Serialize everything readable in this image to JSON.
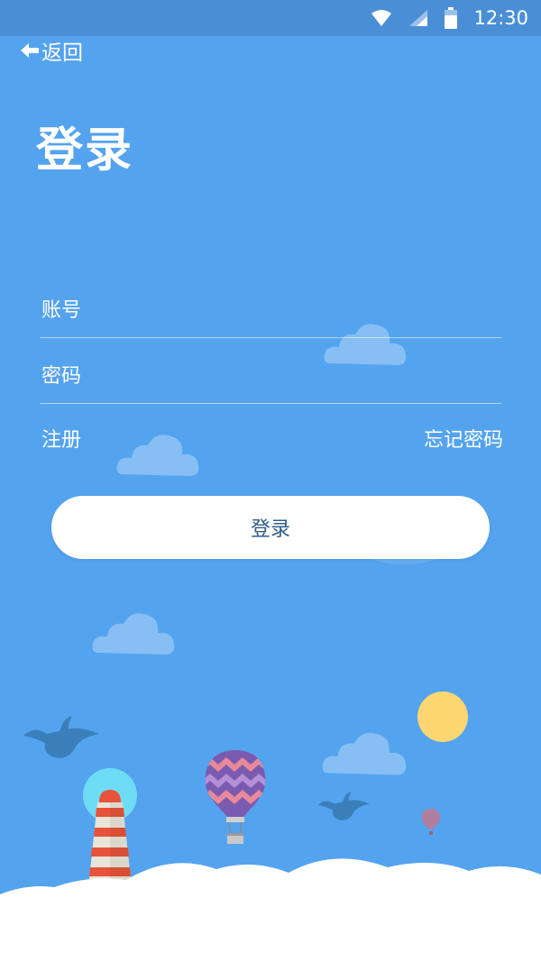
{
  "status_bar": {
    "time": "12:30",
    "icons": [
      "wifi-icon",
      "signal-icon",
      "battery-icon"
    ]
  },
  "nav": {
    "back_label": "返回"
  },
  "page": {
    "title": "登录"
  },
  "form": {
    "account_placeholder": "账号",
    "password_placeholder": "密码",
    "register_label": "注册",
    "forgot_label": "忘记密码",
    "login_button_label": "登录"
  },
  "colors": {
    "background": "#54a3ef",
    "status_bar": "#4a8fd6",
    "button_text": "#2f5c88",
    "sun": "#fcd671",
    "lighthouse_stripe": "#e7533a"
  }
}
